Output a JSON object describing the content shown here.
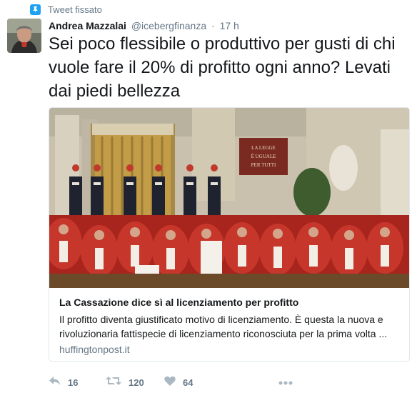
{
  "pinned": {
    "label": "Tweet fissato",
    "icon": "pin-icon"
  },
  "author": {
    "name": "Andrea Mazzalai",
    "handle": "@icebergfinanza",
    "separator": "·",
    "time": "17 h",
    "avatar_icon": "user-avatar"
  },
  "tweet": {
    "text": "Sei poco flessibile o produttivo per gusti di chi vuole fare il 20% di profitto ogni anno? Levati dai piedi bellezza"
  },
  "card": {
    "image_sign": "LA LEGGE È UGUALE PER TUTTI",
    "title": "La Cassazione dice sì al licenziamento per profitto",
    "description": "Il profitto diventa giustificato motivo di licenziamento. È questa la nuova e rivoluzionaria fattispecie di licenziamento riconosciuta per la prima volta ...",
    "domain": "huffingtonpost.it"
  },
  "actions": {
    "reply": {
      "icon": "reply-icon",
      "count": "16"
    },
    "retweet": {
      "icon": "retweet-icon",
      "count": "120"
    },
    "like": {
      "icon": "heart-icon",
      "count": "64"
    },
    "more": {
      "icon": "more-icon"
    }
  },
  "colors": {
    "accent": "#1da1f2",
    "text_secondary": "#657786",
    "border": "#e1e8ed"
  }
}
